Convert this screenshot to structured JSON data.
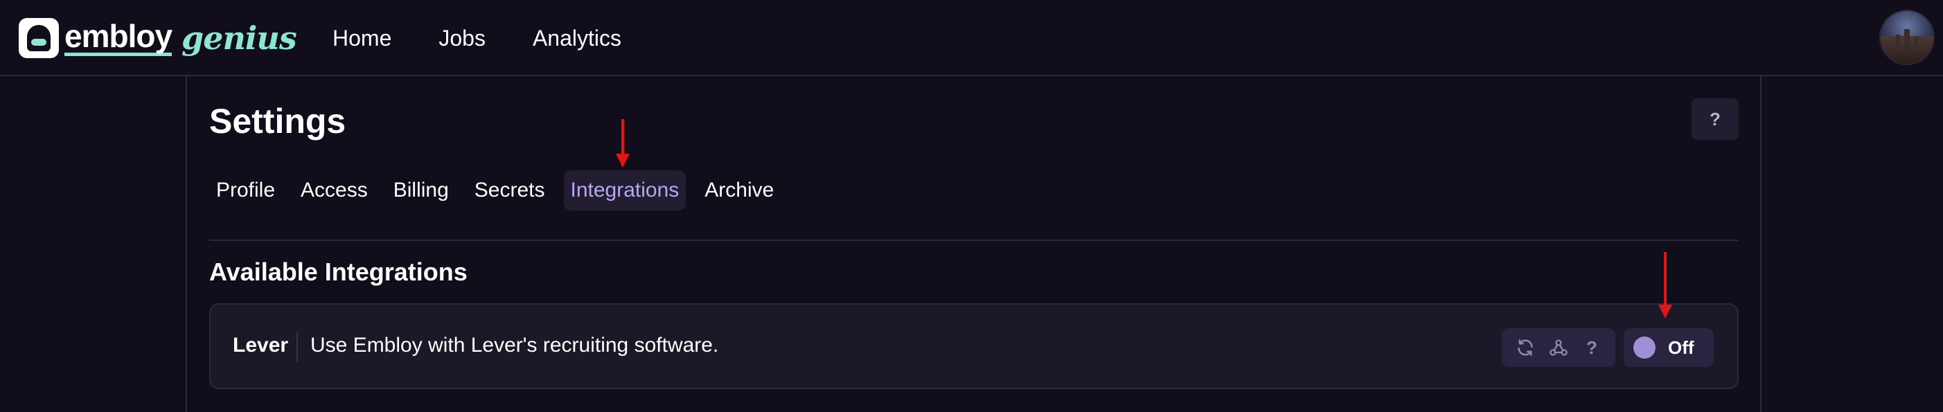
{
  "brand": {
    "name": "embloy",
    "suffix": "genius",
    "accent_color": "#8ee6cf"
  },
  "nav": {
    "items": [
      {
        "label": "Home"
      },
      {
        "label": "Jobs"
      },
      {
        "label": "Analytics"
      }
    ]
  },
  "user": {
    "avatar_icon": "user-avatar-photo"
  },
  "settings": {
    "title": "Settings",
    "help_label": "?",
    "tabs": [
      {
        "label": "Profile",
        "active": false
      },
      {
        "label": "Access",
        "active": false
      },
      {
        "label": "Billing",
        "active": false
      },
      {
        "label": "Secrets",
        "active": false
      },
      {
        "label": "Integrations",
        "active": true
      },
      {
        "label": "Archive",
        "active": false
      }
    ]
  },
  "integrations": {
    "section_title": "Available Integrations",
    "items": [
      {
        "name": "Lever",
        "description": "Use Embloy with Lever's recruiting software.",
        "actions": [
          {
            "icon": "refresh-icon"
          },
          {
            "icon": "webhook-icon"
          },
          {
            "icon": "help-icon",
            "label": "?"
          }
        ],
        "toggle_state": "Off"
      }
    ]
  },
  "colors": {
    "background": "#110d1a",
    "card": "#1c1828",
    "active_tab_text": "#b6a7ee",
    "annotation_arrow": "#e01515"
  }
}
